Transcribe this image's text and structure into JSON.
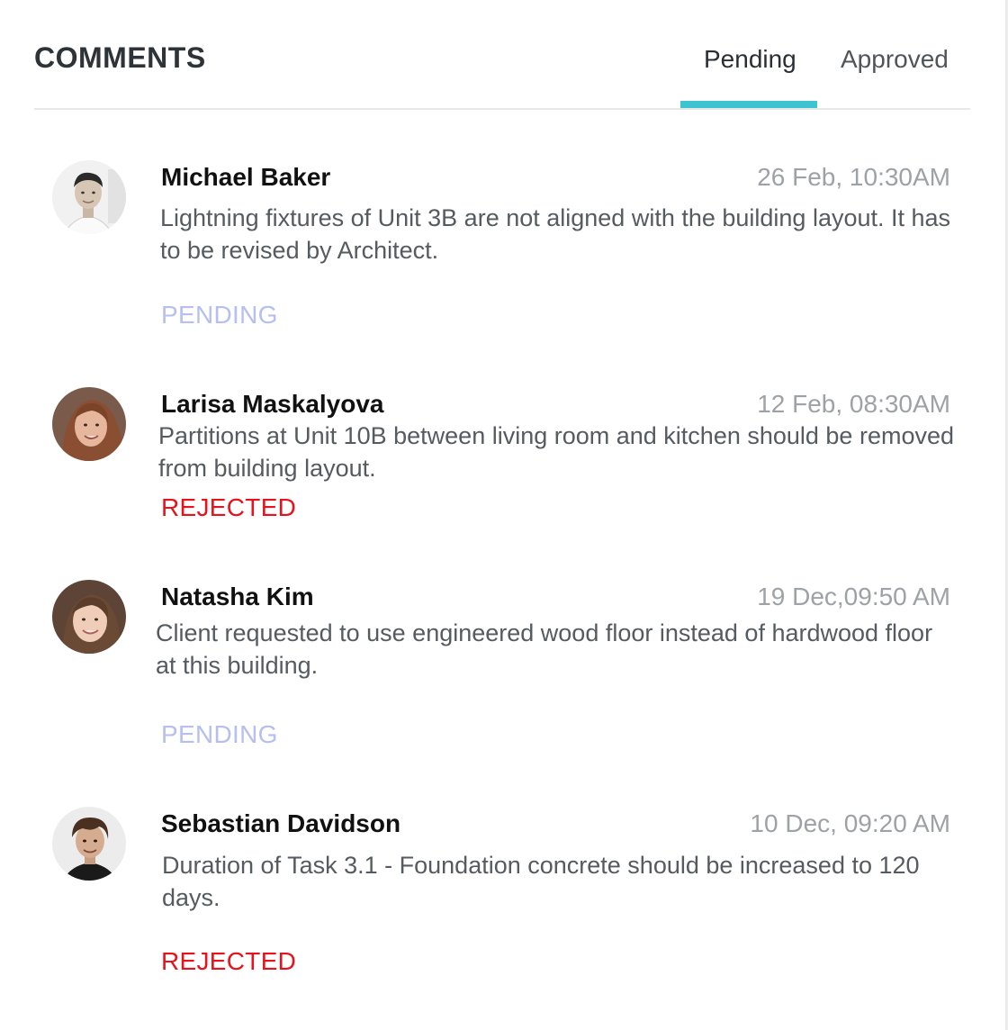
{
  "header": {
    "title": "COMMENTS",
    "tabs": [
      {
        "label": "Pending",
        "active": true
      },
      {
        "label": "Approved",
        "active": false
      }
    ],
    "accent_color": "#3ec3d0"
  },
  "comments": [
    {
      "author": "Michael Baker",
      "timestamp": "26 Feb, 10:30AM",
      "text": "Lightning fixtures of Unit 3B are not aligned with the building layout. It has to be revised by Architect.",
      "status": "PENDING",
      "avatar_icon": "avatar-michael-baker"
    },
    {
      "author": "Larisa Maskalyova",
      "timestamp": "12 Feb, 08:30AM",
      "text": "Partitions at Unit 10B between living room and kitchen should be removed from building layout.",
      "status": "REJECTED",
      "avatar_icon": "avatar-larisa-maskalyova"
    },
    {
      "author": "Natasha Kim",
      "timestamp": "19 Dec,09:50 AM",
      "text": "Client requested to use engineered wood floor instead of hardwood floor at this building.",
      "status": "PENDING",
      "avatar_icon": "avatar-natasha-kim"
    },
    {
      "author": "Sebastian Davidson",
      "timestamp": "10 Dec, 09:20 AM",
      "text": "Duration of Task 3.1 - Foundation concrete should be increased to 120 days.",
      "status": "REJECTED",
      "avatar_icon": "avatar-sebastian-davidson"
    }
  ],
  "status_colors": {
    "PENDING": "#b6bff0",
    "REJECTED": "#e8121d"
  }
}
